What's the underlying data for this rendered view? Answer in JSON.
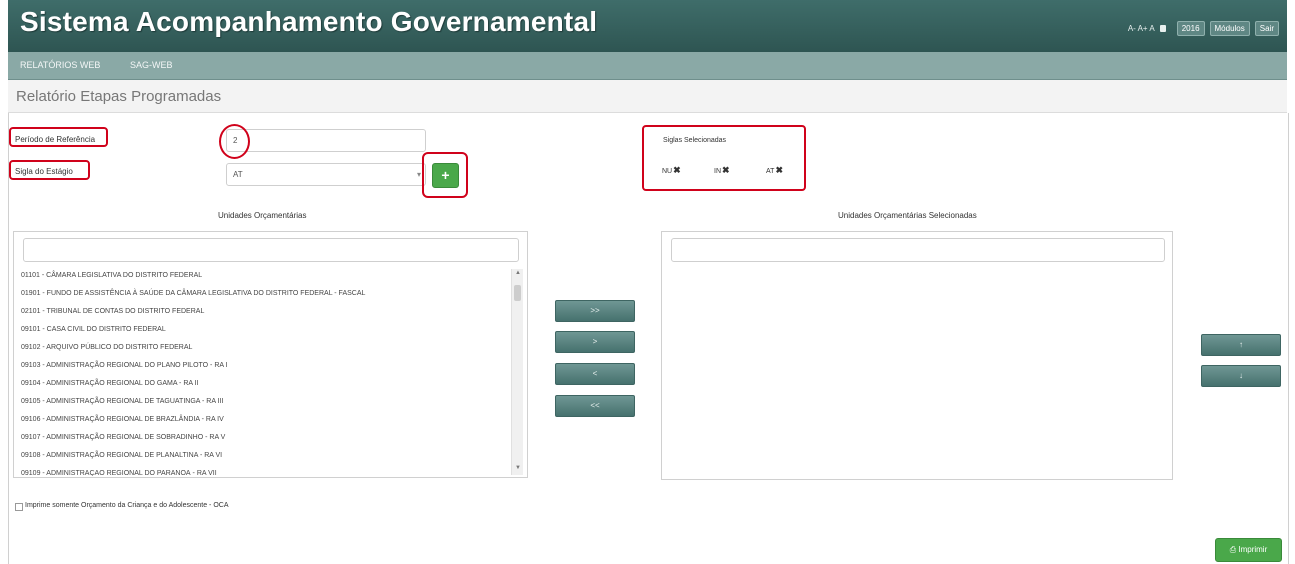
{
  "header": {
    "app_title": "Sistema Acompanhamento Governamental",
    "font_controls": "A- A+ A",
    "year_button": "2016",
    "modulos_button": "Módulos",
    "sair_button": "Sair"
  },
  "menu": {
    "items": [
      "RELATÓRIOS WEB",
      "SAG-WEB"
    ]
  },
  "page": {
    "title": "Relatório Etapas Programadas"
  },
  "form": {
    "periodo_label": "Período de Referência",
    "periodo_value": "2",
    "sigla_estagio_label": "Sigla do Estágio",
    "sigla_estagio_value": "AT",
    "add_button": "+"
  },
  "siglas_selecionadas": {
    "title": "Siglas Selecionadas",
    "items": [
      "NU",
      "IN",
      "AT"
    ],
    "remove_glyph": "✖"
  },
  "unidades": {
    "title": "Unidades Orçamentárias",
    "filter_value": "",
    "items": [
      "01101 - CÂMARA LEGISLATIVA DO DISTRITO FEDERAL",
      "01901 - FUNDO DE ASSISTÊNCIA À SAÚDE DA CÂMARA LEGISLATIVA DO DISTRITO FEDERAL - FASCAL",
      "02101 - TRIBUNAL DE CONTAS DO DISTRITO FEDERAL",
      "09101 - CASA CIVIL DO DISTRITO FEDERAL",
      "09102 - ARQUIVO PÚBLICO DO DISTRITO FEDERAL",
      "09103 - ADMINISTRAÇÃO REGIONAL DO PLANO PILOTO - RA I",
      "09104 - ADMINISTRAÇÃO REGIONAL DO GAMA - RA II",
      "09105 - ADMINISTRAÇÃO REGIONAL DE TAGUATINGA - RA III",
      "09106 - ADMINISTRAÇÃO REGIONAL DE BRAZLÂNDIA - RA IV",
      "09107 - ADMINISTRAÇÃO REGIONAL DE SOBRADINHO - RA V",
      "09108 - ADMINISTRAÇÃO REGIONAL DE PLANALTINA - RA VI",
      "09109 - ADMINISTRAÇÃO REGIONAL DO PARANOÁ - RA VII"
    ]
  },
  "selecionadas": {
    "title": "Unidades Orçamentárias Selecionadas",
    "filter_value": ""
  },
  "move_buttons": [
    ">>",
    ">",
    "<",
    "<<"
  ],
  "order_buttons": [
    "↑",
    "↓"
  ],
  "checkbox_label": "Imprime somente Orçamento da Criança e do Adolescente - OCA",
  "print_button": "Imprimir"
}
